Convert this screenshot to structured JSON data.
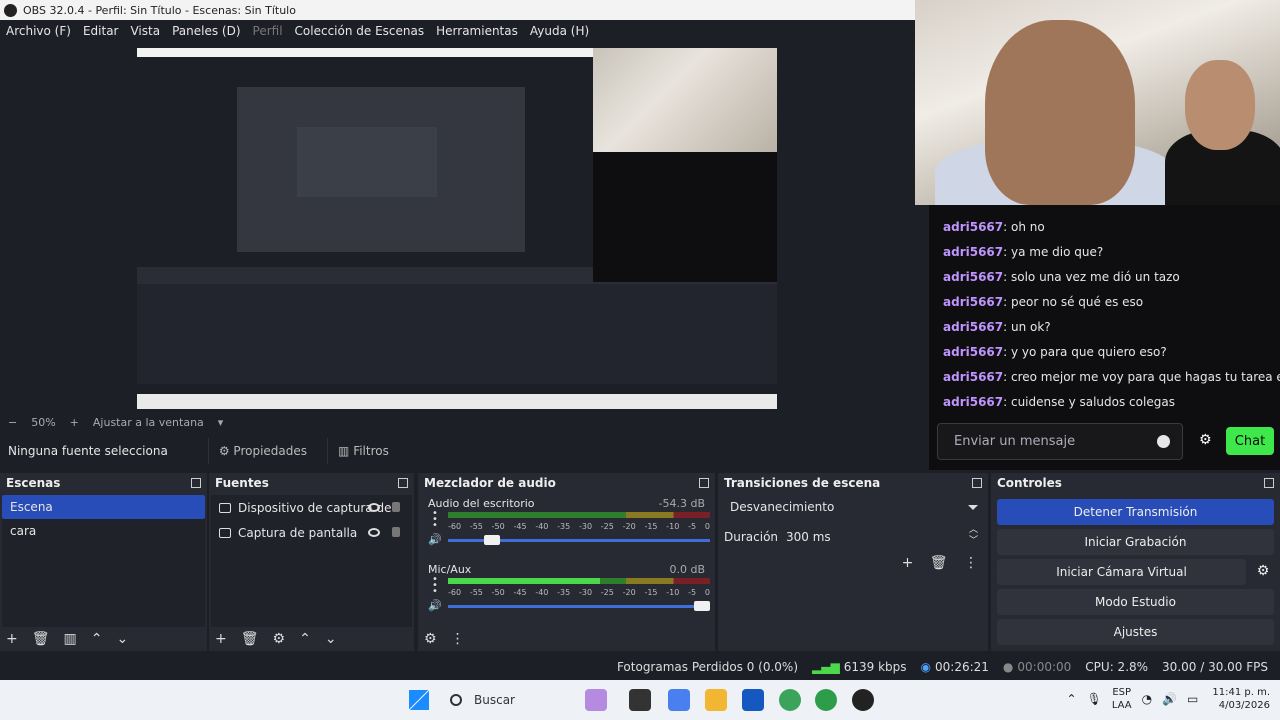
{
  "window": {
    "title": "OBS 32.0.4 - Perfil: Sin Título - Escenas: Sin Título"
  },
  "menu": [
    {
      "label": "Archivo (F)",
      "enabled": true
    },
    {
      "label": "Editar",
      "enabled": true
    },
    {
      "label": "Vista",
      "enabled": true
    },
    {
      "label": "Paneles (D)",
      "enabled": true
    },
    {
      "label": "Perfil",
      "enabled": false
    },
    {
      "label": "Colección de Escenas",
      "enabled": true
    },
    {
      "label": "Herramientas",
      "enabled": true
    },
    {
      "label": "Ayuda (H)",
      "enabled": true
    }
  ],
  "zoom": {
    "minus": "−",
    "value": "50%",
    "plus": "+",
    "fit_label": "Ajustar a la ventana"
  },
  "source_toolbar": {
    "no_source": "Ninguna fuente selecciona",
    "properties": "Propiedades",
    "filters": "Filtros"
  },
  "chat": {
    "messages": [
      {
        "user": "adri5667",
        "text": ": oh no"
      },
      {
        "user": "adri5667",
        "text": ": ya me dio que?"
      },
      {
        "user": "adri5667",
        "text": ": solo una vez me dió un tazo"
      },
      {
        "user": "adri5667",
        "text": ": peor no sé qué es eso"
      },
      {
        "user": "adri5667",
        "text": ": un ok?"
      },
      {
        "user": "adri5667",
        "text": ": y yo para que quiero eso?"
      },
      {
        "user": "adri5667",
        "text": ": creo mejor me voy para que hagas tu tarea en paz"
      },
      {
        "user": "adri5667",
        "text": ": cuidense y saludos colegas"
      }
    ],
    "input_placeholder": "Enviar un mensaje",
    "send_label": "Chat"
  },
  "scenes": {
    "title": "Escenas",
    "items": [
      {
        "label": "Escena",
        "selected": true
      },
      {
        "label": "cara",
        "selected": false
      }
    ]
  },
  "sources": {
    "title": "Fuentes",
    "items": [
      {
        "label": "Dispositivo de captura de"
      },
      {
        "label": "Captura de pantalla"
      }
    ]
  },
  "mixer": {
    "title": "Mezclador de audio",
    "scale": [
      "-60",
      "-55",
      "-50",
      "-45",
      "-40",
      "-35",
      "-30",
      "-25",
      "-20",
      "-15",
      "-10",
      "-5",
      "0"
    ],
    "channels": [
      {
        "name": "Audio del escritorio",
        "db": "-54.3 dB",
        "level": 0,
        "volume": 0.2
      },
      {
        "name": "Mic/Aux",
        "db": "0.0 dB",
        "level": 0.58,
        "volume": 1.0
      }
    ]
  },
  "transitions": {
    "title": "Transiciones de escena",
    "selected": "Desvanecimiento",
    "duration_label": "Duración",
    "duration_value": "300 ms"
  },
  "controls": {
    "title": "Controles",
    "buttons": [
      {
        "label": "Detener Transmisión",
        "primary": true
      },
      {
        "label": "Iniciar Grabación",
        "primary": false
      },
      {
        "label": "Iniciar Cámara Virtual",
        "primary": false
      },
      {
        "label": "Modo Estudio",
        "primary": false
      },
      {
        "label": "Ajustes",
        "primary": false
      }
    ]
  },
  "status": {
    "dropped_frames": "Fotogramas Perdidos 0 (0.0%)",
    "bitrate": "6139 kbps",
    "stream_time": "00:26:21",
    "rec_time": "00:00:00",
    "cpu": "CPU: 2.8%",
    "fps": "30.00 / 30.00 FPS"
  },
  "taskbar": {
    "search_label": "Buscar",
    "lang": "ESP",
    "layout": "LAA",
    "time": "11:41 p. m.",
    "date": "4/03/2026"
  },
  "colors": {
    "accent": "#284cb8",
    "chat_user": "#bf94ff",
    "chat_button": "#3ee84a",
    "meter_green": "#4bd94b"
  }
}
